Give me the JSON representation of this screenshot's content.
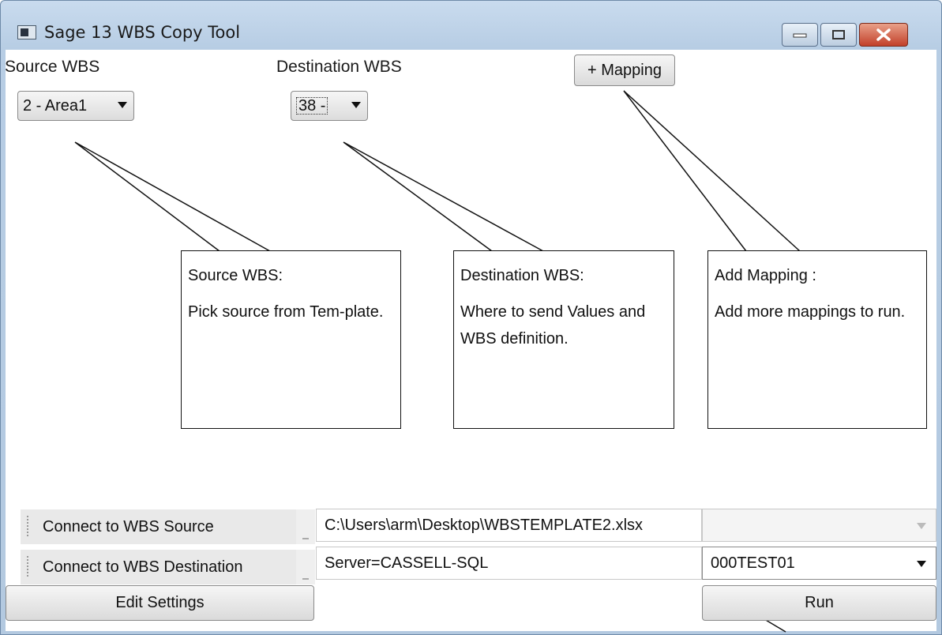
{
  "window": {
    "title": "Sage 13 WBS Copy Tool",
    "app_icon": "app-window-icon",
    "controls": [
      "minimize-icon",
      "maximize-icon",
      "close-icon"
    ]
  },
  "header": {
    "source_label": "Source WBS",
    "destination_label": "Destination WBS",
    "source_select_value": "2 - Area1",
    "destination_select_value": "38 -",
    "add_mapping_button": "+ Mapping"
  },
  "callouts": {
    "source": {
      "title": "Source WBS:",
      "body": "Pick source from Tem-plate."
    },
    "destination": {
      "title": "Destination WBS:",
      "body": "Where to send Values and WBS definition."
    },
    "mapping": {
      "title": "Add Mapping :",
      "body": "Add more mappings to run."
    }
  },
  "footer": {
    "connect_source_button": "Connect to WBS Source",
    "connect_destination_button": "Connect to WBS Destination",
    "source_path_value": "C:\\Users\\arm\\Desktop\\WBSTEMPLATE2.xlsx",
    "destination_server_value": "Server=CASSELL-SQL",
    "source_sheet_value": "",
    "destination_db_value": "000TEST01",
    "edit_settings_button": "Edit Settings",
    "run_button": "Run"
  },
  "colors": {
    "frame": "#b7cde4",
    "close_button": "#c2402a",
    "button_face": "#dadada"
  }
}
